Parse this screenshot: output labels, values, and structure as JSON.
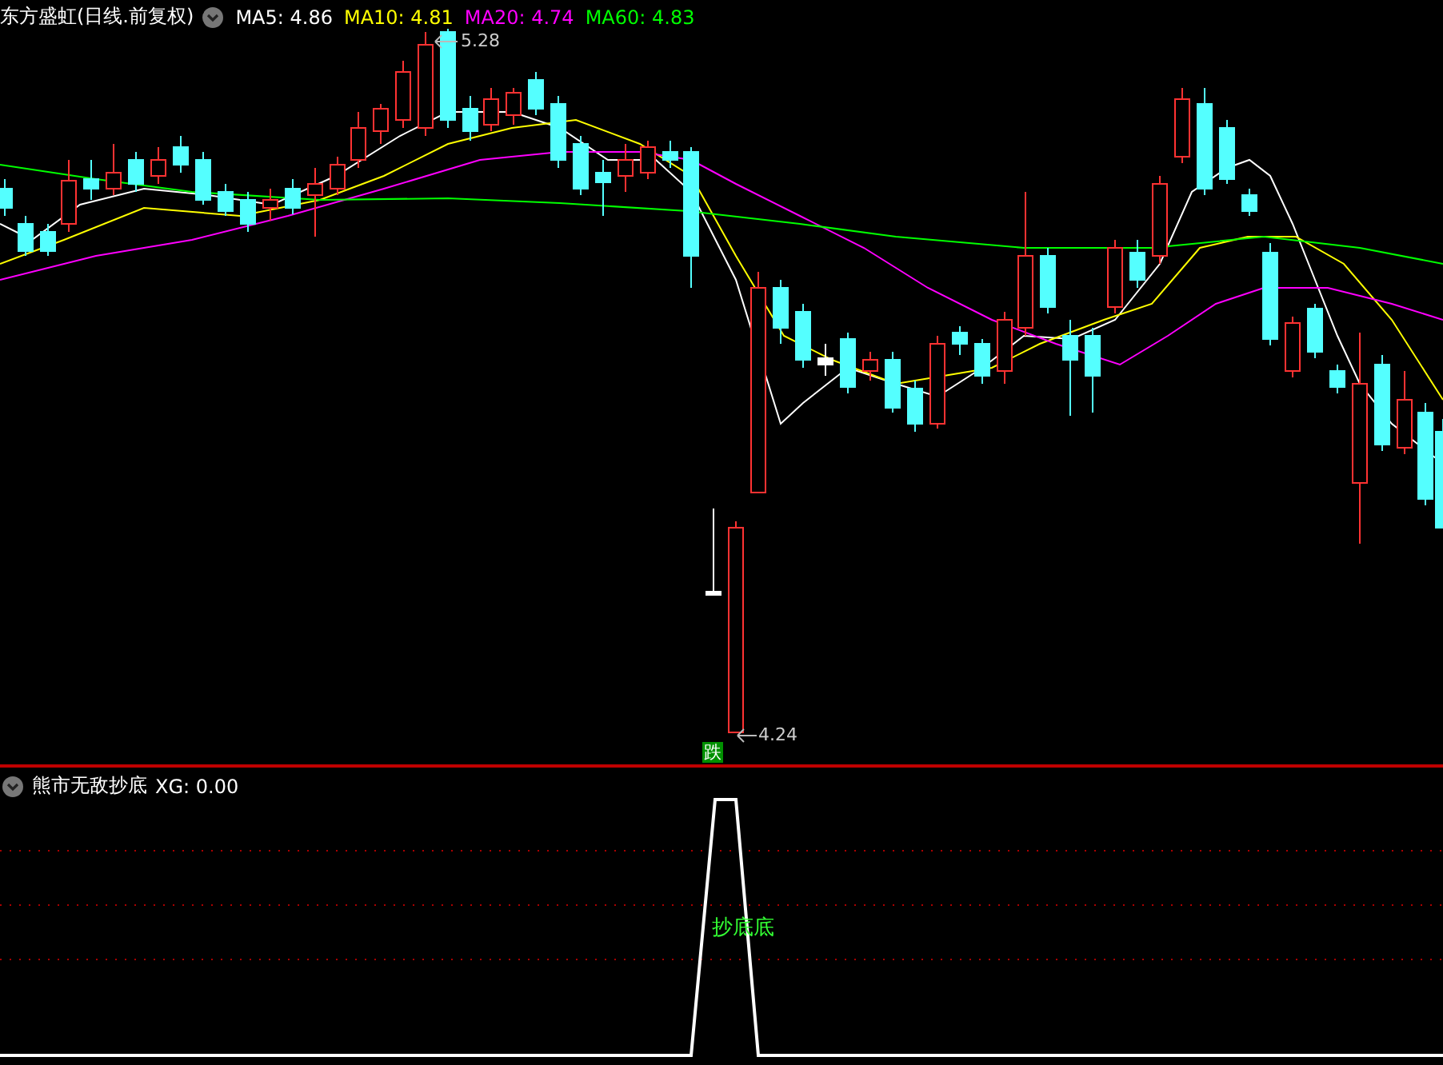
{
  "main_panel": {
    "title": "东方盛虹(日线.前复权)",
    "ma_readings": [
      {
        "label": "MA5: 4.86",
        "color": "#ffffff"
      },
      {
        "label": "MA10: 4.81",
        "color": "#ffff00"
      },
      {
        "label": "MA20: 4.74",
        "color": "#ff00ff"
      },
      {
        "label": "MA60: 4.83",
        "color": "#00ff00"
      }
    ],
    "high_label": "5.28",
    "low_label": "4.24",
    "signal_badge": "跌"
  },
  "indicator_panel": {
    "title": "熊市无敌抄底",
    "reading": "XG: 0.00",
    "signal_label": "抄底底"
  }
}
